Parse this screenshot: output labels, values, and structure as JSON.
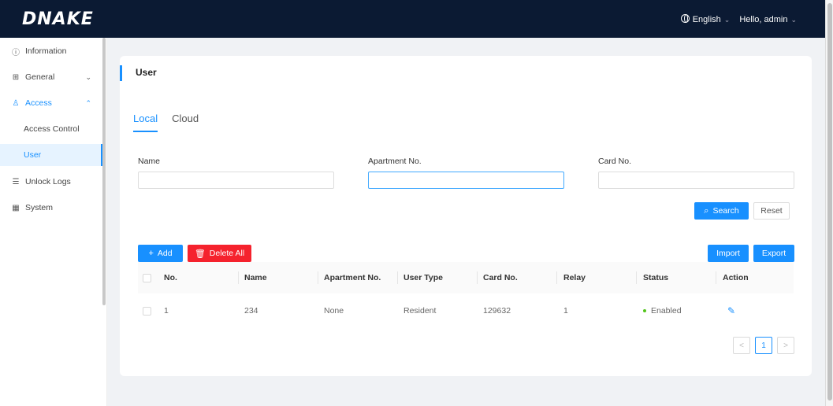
{
  "header": {
    "logo": "DNAKE",
    "language": "English",
    "user_greeting": "Hello, admin"
  },
  "sidebar": {
    "items": [
      {
        "label": "Information",
        "icon": "info-icon"
      },
      {
        "label": "General",
        "icon": "grid-icon"
      },
      {
        "label": "Access",
        "icon": "user-icon"
      },
      {
        "label": "Access Control"
      },
      {
        "label": "User"
      },
      {
        "label": "Unlock Logs",
        "icon": "list-icon"
      },
      {
        "label": "System",
        "icon": "system-icon"
      }
    ]
  },
  "card": {
    "title": "User",
    "tabs": [
      {
        "label": "Local"
      },
      {
        "label": "Cloud"
      }
    ],
    "filters": {
      "name_label": "Name",
      "name_value": "",
      "apartment_label": "Apartment No.",
      "apartment_value": "",
      "card_label": "Card No.",
      "card_value": ""
    },
    "buttons": {
      "search": "Search",
      "reset": "Reset",
      "add": "Add",
      "delete_all": "Delete All",
      "import": "Import",
      "export": "Export"
    },
    "table": {
      "columns": [
        "No.",
        "Name",
        "Apartment No.",
        "User Type",
        "Card No.",
        "Relay",
        "Status",
        "Action"
      ],
      "rows": [
        {
          "no": "1",
          "name": "234",
          "apartment": "None",
          "user_type": "Resident",
          "card_no": "129632",
          "relay": "1",
          "status": "Enabled"
        }
      ]
    },
    "pagination": {
      "prev": "<",
      "current_page": "1",
      "next": ">"
    }
  },
  "colors": {
    "accent": "#1890ff",
    "danger": "#f5222d",
    "topbar": "#0b1a33",
    "status_enabled": "#52c41a"
  }
}
